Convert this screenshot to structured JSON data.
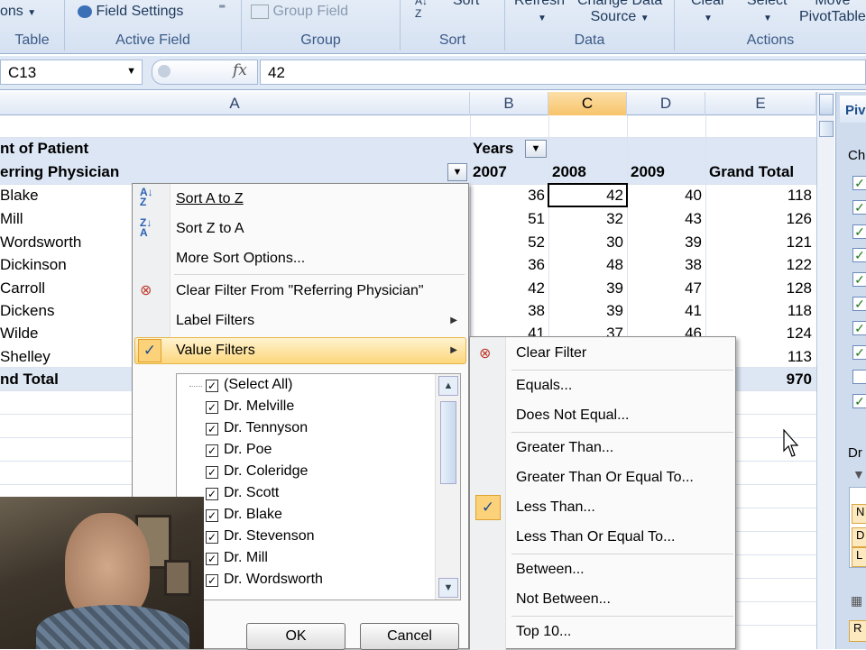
{
  "ribbon": {
    "partial_left": "ons",
    "field_settings": "Field Settings",
    "group_field": "Group Field",
    "sort_btn": "Sort",
    "refresh": "Refresh",
    "change_data": "Change Data",
    "source": "Source",
    "clear": "Clear",
    "select": "Select",
    "move": "Move",
    "pivottable": "PivotTable",
    "groups": [
      "Table",
      "Active Field",
      "Group",
      "Sort",
      "Data",
      "Actions"
    ]
  },
  "formula_bar": {
    "name_box": "C13",
    "fx": "fx",
    "value": "42"
  },
  "columns": [
    "A",
    "B",
    "C",
    "D",
    "E"
  ],
  "pivot": {
    "title1": "nt of Patient",
    "title2": "erring Physician",
    "years_label": "Years",
    "year_headers": [
      "2007",
      "2008",
      "2009",
      "Grand Total"
    ],
    "rows": [
      {
        "name": "Blake",
        "v": [
          "36",
          "42",
          "40",
          "118"
        ]
      },
      {
        "name": "Mill",
        "v": [
          "51",
          "32",
          "43",
          "126"
        ]
      },
      {
        "name": "Wordsworth",
        "v": [
          "52",
          "30",
          "39",
          "121"
        ]
      },
      {
        "name": "Dickinson",
        "v": [
          "36",
          "48",
          "38",
          "122"
        ]
      },
      {
        "name": "Carroll",
        "v": [
          "42",
          "39",
          "47",
          "128"
        ]
      },
      {
        "name": "Dickens",
        "v": [
          "38",
          "39",
          "41",
          "118"
        ]
      },
      {
        "name": "Wilde",
        "v": [
          "41",
          "37",
          "46",
          "124"
        ]
      },
      {
        "name": "Shelley",
        "v": [
          "",
          "",
          "",
          "113"
        ]
      }
    ],
    "grand_total_label": "nd Total",
    "grand_total_value": "970"
  },
  "filter_menu": {
    "sort_az": "Sort A to Z",
    "sort_za": "Sort Z to A",
    "more_sort": "More Sort Options...",
    "clear_filter": "Clear Filter From \"Referring Physician\"",
    "label_filters": "Label Filters",
    "value_filters": "Value Filters",
    "list": [
      "(Select All)",
      "Dr. Melville",
      "Dr. Tennyson",
      "Dr. Poe",
      "Dr. Coleridge",
      "Dr. Scott",
      "Dr. Blake",
      "Dr. Stevenson",
      "Dr. Mill",
      "Dr. Wordsworth"
    ],
    "ok": "OK",
    "cancel": "Cancel"
  },
  "value_filters_menu": {
    "items": [
      "Clear Filter",
      "Equals...",
      "Does Not Equal...",
      "Greater Than...",
      "Greater Than Or Equal To...",
      "Less Than...",
      "Less Than Or Equal To...",
      "Between...",
      "Not Between...",
      "Top 10..."
    ],
    "checked": "Less Than..."
  },
  "pane": {
    "title": "PivotTable",
    "ch": "Ch",
    "dr": "Dr",
    "letters": [
      "N",
      "D",
      "L"
    ],
    "r": "R"
  }
}
